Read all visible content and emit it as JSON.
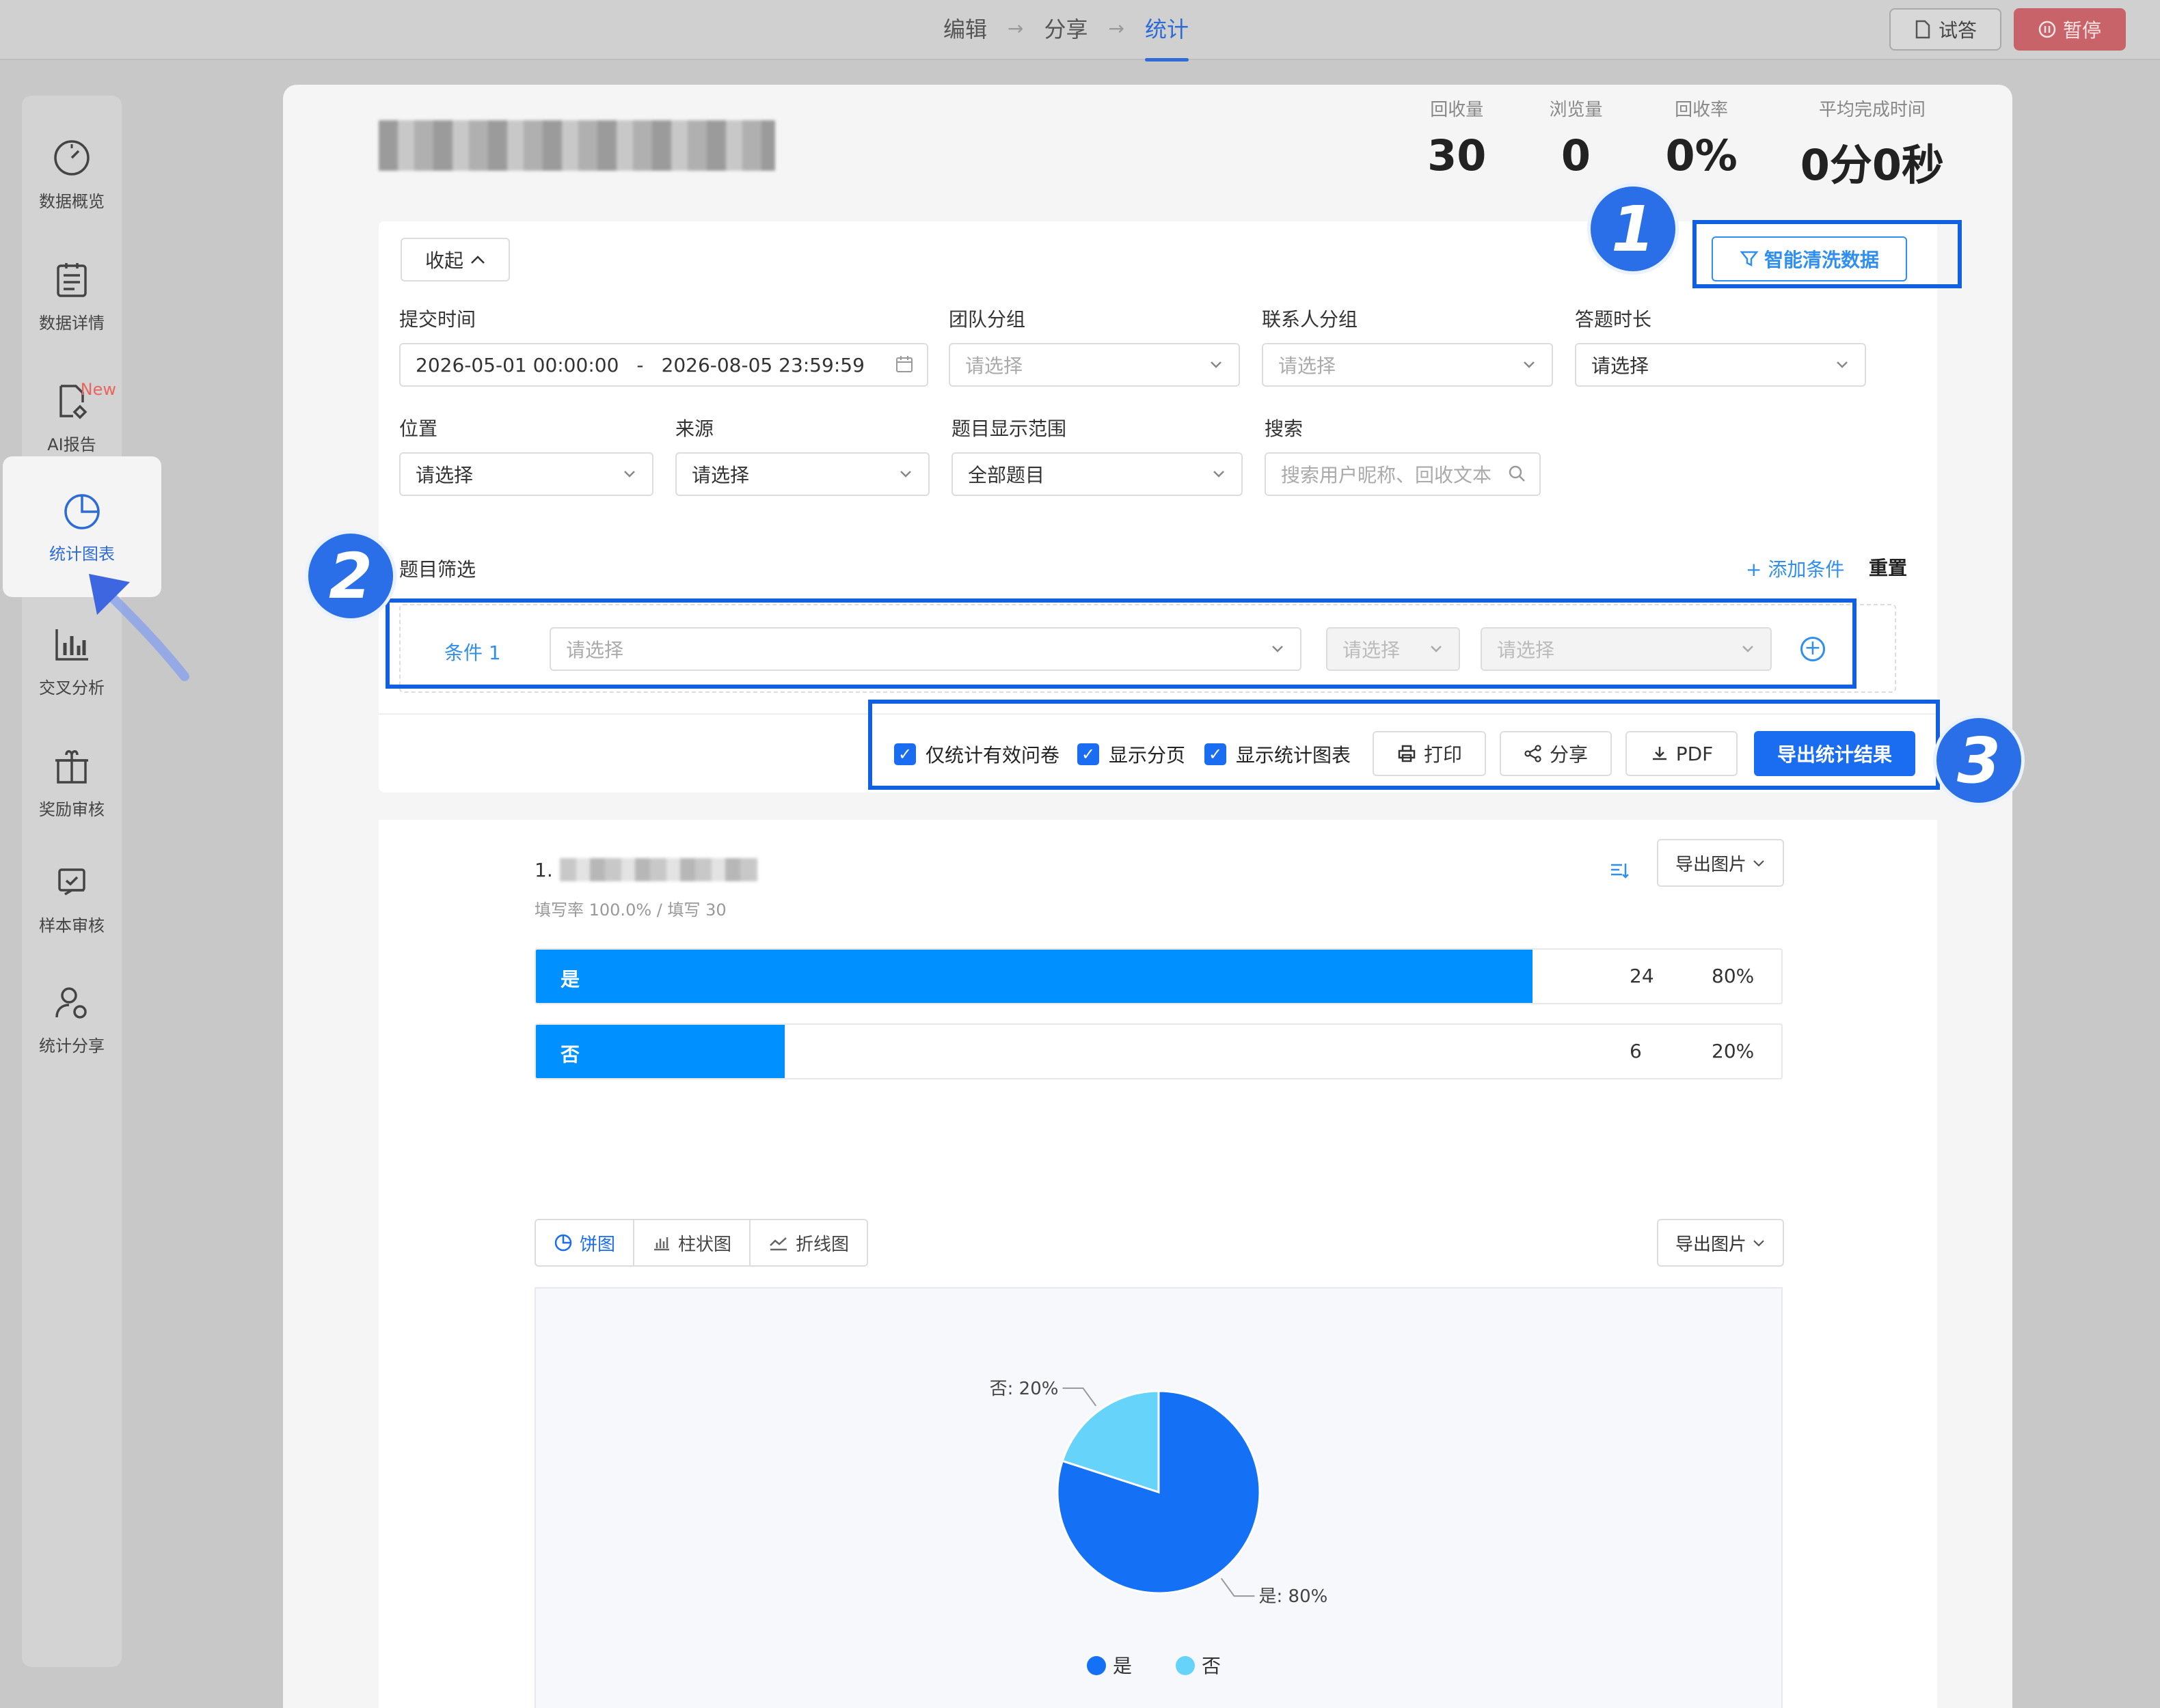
{
  "topbar": {
    "steps": [
      "编辑",
      "分享",
      "统计"
    ],
    "active_step": "统计",
    "try_button": "试答",
    "pause_button": "暂停"
  },
  "sidebar": {
    "items": [
      {
        "label": "数据概览",
        "icon": "dashboard-icon"
      },
      {
        "label": "数据详情",
        "icon": "clipboard-icon"
      },
      {
        "label": "AI报告",
        "icon": "ai-report-icon",
        "badge": "New"
      },
      {
        "label": "统计图表",
        "icon": "pie-chart-icon",
        "active": true
      },
      {
        "label": "交叉分析",
        "icon": "bar-chart-icon"
      },
      {
        "label": "奖励审核",
        "icon": "gift-icon"
      },
      {
        "label": "样本审核",
        "icon": "review-icon"
      },
      {
        "label": "统计分享",
        "icon": "user-share-icon"
      }
    ]
  },
  "summary": {
    "stats": [
      {
        "label": "回收量",
        "value": "30"
      },
      {
        "label": "浏览量",
        "value": "0"
      },
      {
        "label": "回收率",
        "value": "0%"
      },
      {
        "label": "平均完成时间",
        "value": "0分0秒"
      }
    ]
  },
  "filters": {
    "collapse": "收起",
    "smart_clean": "智能清洗数据",
    "submit_time_label": "提交时间",
    "date_start": "2026-05-01 00:00:00",
    "date_sep": "-",
    "date_end": "2026-08-05 23:59:59",
    "team_group_label": "团队分组",
    "team_group_value": "请选择",
    "contact_group_label": "联系人分组",
    "contact_group_value": "请选择",
    "duration_label": "答题时长",
    "duration_value": "请选择",
    "location_label": "位置",
    "location_value": "请选择",
    "source_label": "来源",
    "source_value": "请选择",
    "scope_label": "题目显示范围",
    "scope_value": "全部题目",
    "search_label": "搜索",
    "search_placeholder": "搜索用户昵称、回收文本",
    "question_filter_label": "题目筛选",
    "add_condition": "+ 添加条件",
    "reset": "重置",
    "condition_label": "条件 1",
    "condition_select": "请选择",
    "condition_op": "请选择",
    "condition_value": "请选择"
  },
  "toolbar": {
    "only_valid": "仅统计有效问卷",
    "show_paging": "显示分页",
    "show_charts": "显示统计图表",
    "print": "打印",
    "share": "分享",
    "pdf": "PDF",
    "export": "导出统计结果"
  },
  "annotations": {
    "badge1": "1",
    "badge2": "2",
    "badge3": "3"
  },
  "question": {
    "number": "1.",
    "meta": "填写率 100.0% / 填写 30",
    "export_image": "导出图片",
    "options": [
      {
        "label": "是",
        "count": "24",
        "pct": "80%",
        "fraction": 0.8
      },
      {
        "label": "否",
        "count": "6",
        "pct": "20%",
        "fraction": 0.2
      }
    ],
    "chart_tabs": [
      "饼图",
      "柱状图",
      "折线图"
    ],
    "active_tab": "饼图"
  },
  "colors": {
    "primary": "#1a6cf0",
    "bar": "#0090ff",
    "pie_yes": "#1470f5",
    "pie_no": "#66d3fb"
  },
  "chart_data": {
    "type": "pie",
    "categories": [
      "是",
      "否"
    ],
    "values": [
      80,
      20
    ],
    "slice_labels": [
      "是: 80%",
      "否: 20%"
    ],
    "legend": [
      "是",
      "否"
    ]
  }
}
